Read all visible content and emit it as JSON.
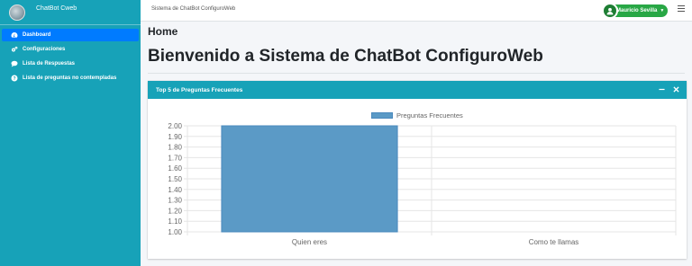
{
  "sidebar": {
    "brand": "ChatBot Cweb",
    "items": [
      {
        "label": "Dashboard",
        "icon": "dashboard-icon"
      },
      {
        "label": "Configuraciones",
        "icon": "gears-icon"
      },
      {
        "label": "Lista de Respuestas",
        "icon": "comment-icon"
      },
      {
        "label": "Lista de preguntas no contempladas",
        "icon": "question-circle-icon"
      }
    ]
  },
  "topbar": {
    "title": "Sistema de ChatBot ConfiguroWeb",
    "user": "Mauricio Sevilla",
    "menu_icon": "hamburger-icon"
  },
  "page": {
    "breadcrumb": "Home",
    "title": "Bienvenido a Sistema de ChatBot ConfiguroWeb"
  },
  "card": {
    "title": "Top 5 de Preguntas Frecuentes",
    "tools": [
      "minus-icon",
      "close-icon"
    ]
  },
  "colors": {
    "sidebar": "#17a2b8",
    "active": "#007bff",
    "user_badge": "#28a745",
    "bar": "#5b9ac6"
  },
  "chart_data": {
    "type": "bar",
    "categories": [
      "Quien eres",
      "Como te llamas"
    ],
    "series": [
      {
        "name": "Preguntas Frecuentes",
        "values": [
          2,
          1
        ]
      }
    ],
    "ylim": [
      1.0,
      2.0
    ],
    "yticks": [
      "2.00",
      "1.90",
      "1.80",
      "1.70",
      "1.60",
      "1.50",
      "1.40",
      "1.30",
      "1.20",
      "1.10",
      "1.00"
    ],
    "legend": "top-center",
    "grid": true
  }
}
